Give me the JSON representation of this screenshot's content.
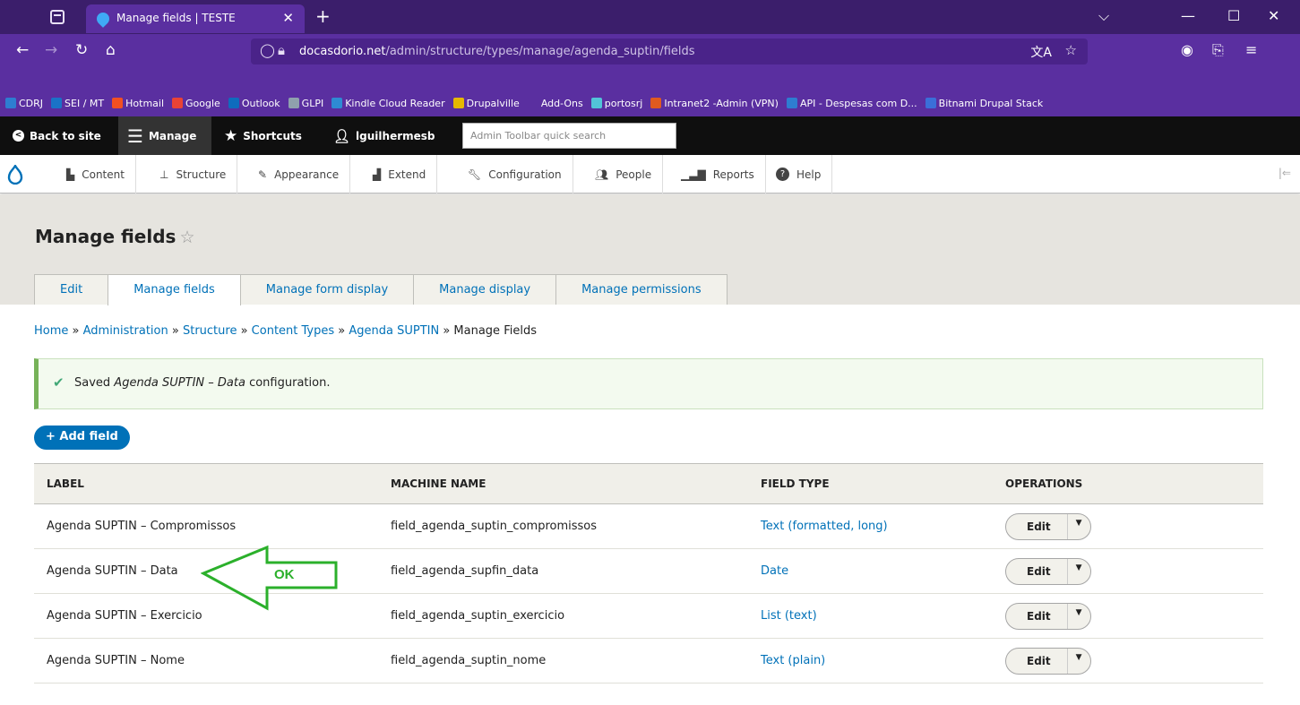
{
  "browser": {
    "tab_title": "Manage fields | TESTE",
    "url_host": "docasdorio.net",
    "url_path": "/admin/structure/types/manage/agenda_suptin/fields"
  },
  "bookmarks": [
    {
      "label": "CDRJ",
      "color": "#2e7dd1"
    },
    {
      "label": "SEI / MT",
      "color": "#1a73c7"
    },
    {
      "label": "Hotmail",
      "color": "#f25022"
    },
    {
      "label": "Google",
      "color": "#ea4335"
    },
    {
      "label": "Outlook",
      "color": "#0f6cbd"
    },
    {
      "label": "GLPI",
      "color": "#8fa1ad"
    },
    {
      "label": "Kindle Cloud Reader",
      "color": "#2e8bd3"
    },
    {
      "label": "Drupalville",
      "color": "#e6b800"
    },
    {
      "label": "Add-Ons",
      "color": "#5a2fa0"
    },
    {
      "label": "portosrj",
      "color": "#52c4d8"
    },
    {
      "label": "Intranet2 -Admin (VPN)",
      "color": "#e05a1f"
    },
    {
      "label": "API - Despesas com D...",
      "color": "#2e7dd1"
    },
    {
      "label": "Bitnami Drupal Stack",
      "color": "#3b6fd8"
    }
  ],
  "admin_toolbar": {
    "back_to_site": "Back to site",
    "manage": "Manage",
    "shortcuts": "Shortcuts",
    "user": "lguilhermesb",
    "search_placeholder": "Admin Toolbar quick search"
  },
  "admin_menu": [
    "Content",
    "Structure",
    "Appearance",
    "Extend",
    "Configuration",
    "People",
    "Reports",
    "Help"
  ],
  "page": {
    "title": "Manage fields",
    "tabs": [
      "Edit",
      "Manage fields",
      "Manage form display",
      "Manage display",
      "Manage permissions"
    ],
    "active_tab": "Manage fields"
  },
  "breadcrumb": {
    "links": [
      "Home",
      "Administration",
      "Structure",
      "Content Types",
      "Agenda SUPTIN"
    ],
    "current": "Manage Fields",
    "sep": " » "
  },
  "message": {
    "prefix": "Saved ",
    "emphasis": "Agenda SUPTIN – Data",
    "suffix": " configuration."
  },
  "add_field_button": "+ Add field",
  "table": {
    "headers": [
      "Label",
      "Machine name",
      "Field type",
      "Operations"
    ],
    "rows": [
      {
        "label": "Agenda SUPTIN – Compromissos",
        "machine": "field_agenda_suptin_compromissos",
        "type": "Text (formatted, long)",
        "op": "Edit"
      },
      {
        "label": "Agenda SUPTIN – Data",
        "machine": "field_agenda_supfin_data",
        "type": "Date",
        "op": "Edit"
      },
      {
        "label": "Agenda SUPTIN – Exercicio",
        "machine": "field_agenda_suptin_exercicio",
        "type": "List (text)",
        "op": "Edit"
      },
      {
        "label": "Agenda SUPTIN – Nome",
        "machine": "field_agenda_suptin_nome",
        "type": "Text (plain)",
        "op": "Edit"
      }
    ]
  },
  "annotation": {
    "text": "OK",
    "color": "#2bb02b"
  }
}
